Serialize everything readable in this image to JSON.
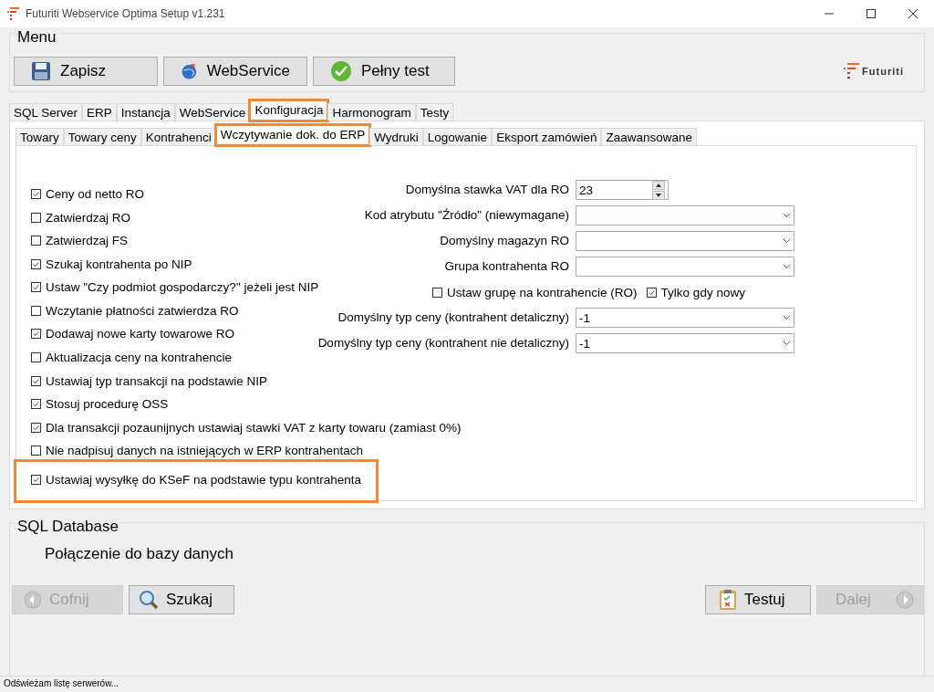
{
  "window": {
    "title": "Futuriti Webservice Optima Setup v1.231"
  },
  "menu": {
    "title": "Menu",
    "buttons": [
      {
        "label": "Zapisz",
        "kind": "save"
      },
      {
        "label": "WebService",
        "kind": "globe"
      },
      {
        "label": "Pełny test",
        "kind": "check"
      }
    ],
    "logo": "Futuriti"
  },
  "tabs": [
    {
      "label": "SQL Server",
      "selected": false,
      "highlighted": false
    },
    {
      "label": "ERP",
      "selected": false,
      "highlighted": false
    },
    {
      "label": "Instancja",
      "selected": false,
      "highlighted": false
    },
    {
      "label": "WebService",
      "selected": false,
      "highlighted": false
    },
    {
      "label": "Konfiguracja",
      "selected": true,
      "highlighted": true
    },
    {
      "label": "Harmonogram",
      "selected": false,
      "highlighted": false
    },
    {
      "label": "Testy",
      "selected": false,
      "highlighted": false
    }
  ],
  "subtabs": [
    {
      "label": "Towary",
      "selected": false,
      "highlighted": false
    },
    {
      "label": "Towary ceny",
      "selected": false,
      "highlighted": false
    },
    {
      "label": "Kontrahenci",
      "selected": false,
      "highlighted": false
    },
    {
      "label": "Wczytywanie dok. do ERP",
      "selected": true,
      "highlighted": true
    },
    {
      "label": "Wydruki",
      "selected": false,
      "highlighted": false
    },
    {
      "label": "Logowanie",
      "selected": false,
      "highlighted": false
    },
    {
      "label": "Eksport zamówień",
      "selected": false,
      "highlighted": false
    },
    {
      "label": "Zaawansowane",
      "selected": false,
      "highlighted": false
    }
  ],
  "options": [
    {
      "label": "Ceny od netto RO",
      "checked": true,
      "highlighted": false
    },
    {
      "label": "Zatwierdzaj RO",
      "checked": false,
      "highlighted": false
    },
    {
      "label": "Zatwierdzaj FS",
      "checked": false,
      "highlighted": false
    },
    {
      "label": "Szukaj kontrahenta po NIP",
      "checked": true,
      "highlighted": false
    },
    {
      "label": "Ustaw \"Czy podmiot gospodarczy?\" jeżeli jest NIP",
      "checked": true,
      "highlighted": false
    },
    {
      "label": "Wczytanie płatności zatwierdza RO",
      "checked": false,
      "highlighted": false
    },
    {
      "label": "Dodawaj nowe karty towarowe RO",
      "checked": true,
      "highlighted": false
    },
    {
      "label": "Aktualizacja ceny na kontrahencie",
      "checked": false,
      "highlighted": false
    },
    {
      "label": "Ustawiaj typ transakcji na podstawie NIP",
      "checked": true,
      "highlighted": false
    },
    {
      "label": "Stosuj procedurę OSS",
      "checked": true,
      "highlighted": false
    },
    {
      "label": "Dla transakcji pozaunijnych ustawiaj stawki VAT z karty towaru (zamiast 0%)",
      "checked": true,
      "highlighted": false
    },
    {
      "label": "Nie nadpisuj danych na istniejących w ERP kontrahentach",
      "checked": false,
      "highlighted": false
    },
    {
      "label": "Ustawiaj wysyłkę do KSeF na podstawie typu kontrahenta",
      "checked": true,
      "highlighted": true
    }
  ],
  "settings": [
    {
      "kind": "spin",
      "label": "Domyślna stawka VAT dla RO",
      "value": "23"
    },
    {
      "kind": "combo",
      "label": "Kod atrybutu \"Źródło\" (niewymagane)"
    },
    {
      "kind": "combo",
      "label": "Domyślny magazyn RO"
    },
    {
      "kind": "combo",
      "label": "Grupa kontrahenta RO"
    },
    {
      "kind": "checks",
      "items": [
        {
          "label": "Ustaw grupę na kontrahencie (RO)",
          "checked": false
        },
        {
          "label": "Tylko gdy nowy",
          "checked": true
        }
      ]
    },
    {
      "kind": "combo",
      "label": "Domyślny typ ceny (kontrahent detaliczny)",
      "value": "-1"
    },
    {
      "kind": "combo",
      "label": "Domyślny typ ceny (kontrahent nie detaliczny)",
      "value": "-1"
    }
  ],
  "sql_database": {
    "title": "SQL Database",
    "text": "Połączenie do bazy danych"
  },
  "nav": [
    {
      "label": "Cofnij",
      "kind": "back",
      "disabled": true
    },
    {
      "label": "Szukaj",
      "kind": "search",
      "disabled": false
    },
    {
      "label": "Testuj",
      "kind": "test",
      "disabled": false
    },
    {
      "label": "Dalej",
      "kind": "next",
      "disabled": true
    }
  ],
  "status_bar": "Odświeżam listę serwerów..."
}
